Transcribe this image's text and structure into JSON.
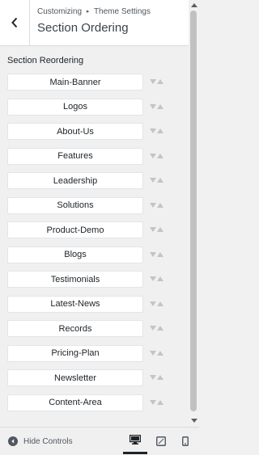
{
  "header": {
    "breadcrumb_root": "Customizing",
    "breadcrumb_leaf": "Theme Settings",
    "title": "Section Ordering"
  },
  "section": {
    "label": "Section Reordering",
    "items": [
      {
        "label": "Main-Banner"
      },
      {
        "label": "Logos"
      },
      {
        "label": "About-Us"
      },
      {
        "label": "Features"
      },
      {
        "label": "Leadership"
      },
      {
        "label": "Solutions"
      },
      {
        "label": "Product-Demo"
      },
      {
        "label": "Blogs"
      },
      {
        "label": "Testimonials"
      },
      {
        "label": "Latest-News"
      },
      {
        "label": "Records"
      },
      {
        "label": "Pricing-Plan"
      },
      {
        "label": "Newsletter"
      },
      {
        "label": "Content-Area"
      }
    ]
  },
  "footer": {
    "hide_controls_label": "Hide Controls",
    "devices": [
      "desktop",
      "tablet",
      "mobile"
    ],
    "active_device": "desktop"
  },
  "icons": {
    "back": "chevron-left-icon",
    "move_down": "arrow-down-icon",
    "move_up": "arrow-up-icon",
    "hide_controls": "collapse-arrow-icon",
    "desktop": "desktop-icon",
    "tablet": "tablet-icon",
    "mobile": "mobile-icon"
  },
  "colors": {
    "accent": "#1d2327",
    "muted": "#50575e",
    "arrow": "#c3c4c7",
    "scroll_thumb": "#c1c1c1"
  }
}
